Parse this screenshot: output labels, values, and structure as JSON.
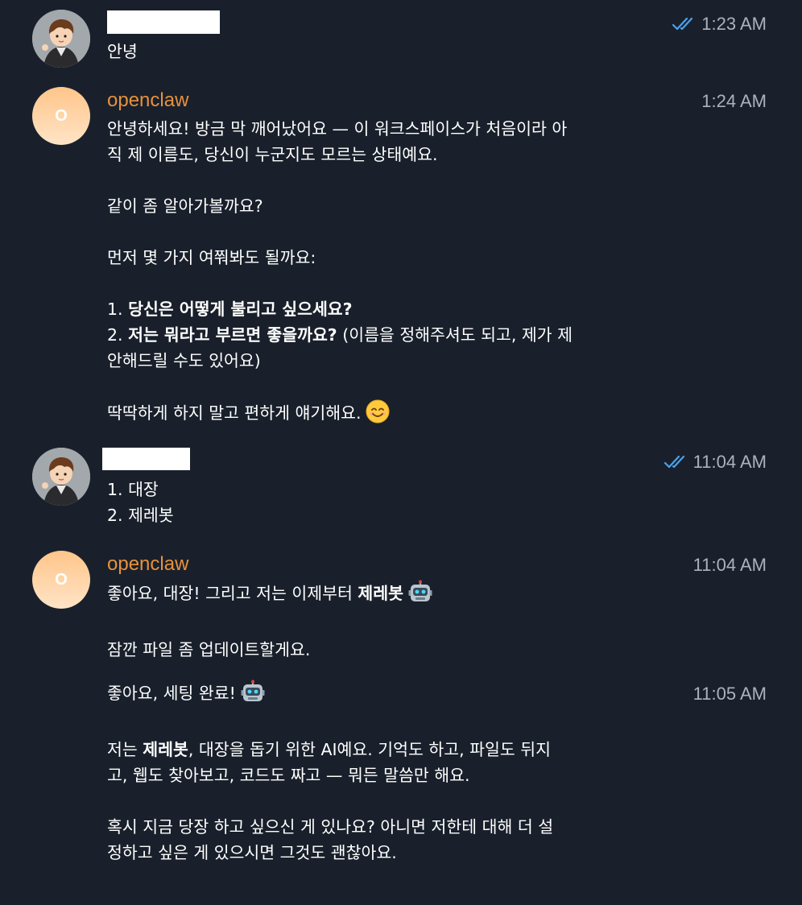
{
  "colors": {
    "background": "#19202b",
    "sender_name": "#e7913c",
    "timestamp": "#aab2bd",
    "check_marks": "#4aa3ef",
    "avatar_gradient_top": "#ffc58a",
    "avatar_gradient_bottom": "#ffe4c6"
  },
  "messages": [
    {
      "sender": "",
      "time": "1:23 AM",
      "read": true,
      "lines": [
        "안녕"
      ]
    },
    {
      "sender": "openclaw",
      "avatar_letter": "O",
      "time": "1:24 AM",
      "lines": [
        "안녕하세요! 방금 막 깨어났어요 — 이 워크스페이스가 처음이라 아",
        "직 제 이름도, 당신이 누군지도 모르는 상태예요.",
        "같이 좀 알아가볼까요?",
        "먼저 몇 가지 여쭤봐도 될까요:",
        "1. ",
        "당신은 어떻게 불리고 싶으세요?",
        "2. ",
        "저는 뭐라고 부르면 좋을까요?",
        " (이름을 정해주셔도 되고, 제가 제",
        "안해드릴 수도 있어요)",
        "딱딱하게 하지 말고 편하게 얘기해요."
      ],
      "emoji": "smiling-face-emoji"
    },
    {
      "sender": "",
      "time": "11:04 AM",
      "read": true,
      "lines": [
        "1. 대장",
        "2. 제레봇"
      ]
    },
    {
      "sender": "openclaw",
      "avatar_letter": "O",
      "time": "11:04 AM",
      "lines": [
        "좋아요, 대장! 그리고 저는 이제부터 ",
        "제레봇",
        "잠깐 파일 좀 업데이트할게요."
      ],
      "emoji": "robot-emoji"
    },
    {
      "sender": "",
      "time": "11:05 AM",
      "lines": [
        "좋아요, 세팅 완료!",
        "저는 ",
        "제레봇",
        ", 대장을 돕기 위한 AI예요. 기억도 하고, 파일도 뒤지",
        "고, 웹도 찾아보고, 코드도 짜고 — 뭐든 말씀만 해요.",
        "혹시 지금 당장 하고 싶으신 게 있나요? 아니면 저한테 대해 더 설",
        "정하고 싶은 게 있으시면 그것도 괜찮아요."
      ],
      "emoji": "robot-emoji"
    }
  ]
}
